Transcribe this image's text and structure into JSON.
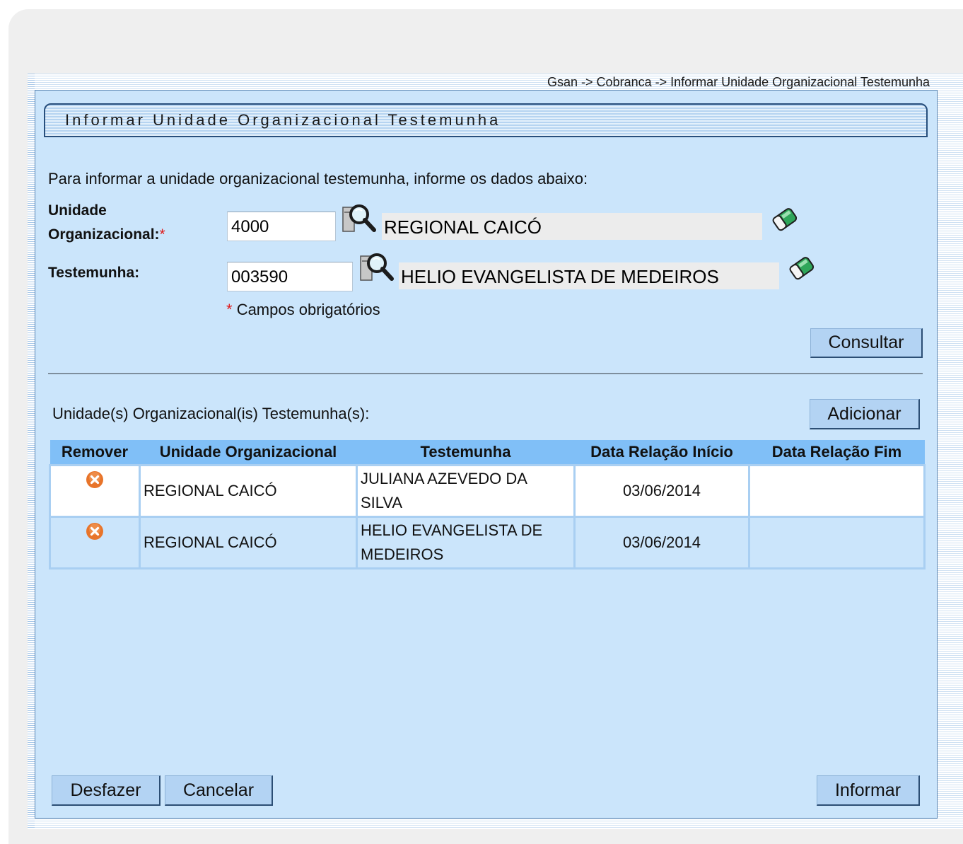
{
  "breadcrumb": "Gsan -> Cobranca -> Informar Unidade Organizacional Testemunha",
  "page_title": "Informar Unidade Organizacional Testemunha",
  "intro": "Para informar a unidade organizacional testemunha, informe os dados abaixo:",
  "form": {
    "unidade_label_1": "Unidade",
    "unidade_label_2": "Organizacional:",
    "required_mark": "*",
    "unidade_code": "4000",
    "unidade_name": "REGIONAL  CAICÓ",
    "testemunha_label": "Testemunha:",
    "testemunha_code": "003590",
    "testemunha_name": "HELIO EVANGELISTA DE MEDEIROS",
    "required_note": "Campos obrigatórios"
  },
  "buttons": {
    "consultar": "Consultar",
    "adicionar": "Adicionar",
    "desfazer": "Desfazer",
    "cancelar": "Cancelar",
    "informar": "Informar"
  },
  "section_label": "Unidade(s) Organizacional(is) Testemunha(s):",
  "table": {
    "headers": [
      "Remover",
      "Unidade Organizacional",
      "Testemunha",
      "Data Relação Início",
      "Data Relação Fim"
    ],
    "rows": [
      {
        "unidade": "REGIONAL CAICÓ",
        "testemunha": "JULIANA AZEVEDO DA SILVA",
        "inicio": "03/06/2014",
        "fim": ""
      },
      {
        "unidade": "REGIONAL CAICÓ",
        "testemunha": "HELIO EVANGELISTA DE MEDEIROS",
        "inicio": "03/06/2014",
        "fim": ""
      }
    ]
  },
  "icons": {
    "search": "search-icon",
    "eraser": "eraser-icon",
    "remove": "remove-icon"
  },
  "colors": {
    "panel_bg": "#cbe5fb",
    "header_bg": "#80bff7",
    "button_bg": "#b3d3f3",
    "remove_icon": "#e8742a",
    "required": "#e01818"
  }
}
